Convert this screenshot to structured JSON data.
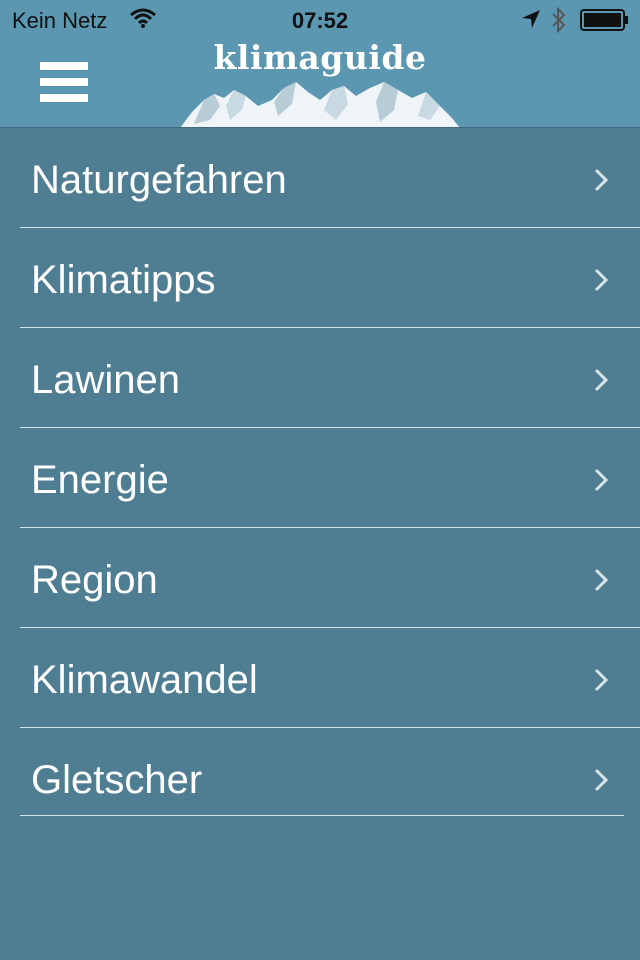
{
  "status_bar": {
    "carrier": "Kein Netz",
    "time": "07:52"
  },
  "header": {
    "logo_text": "klimaguide",
    "menu_icon": "hamburger-menu-icon"
  },
  "menu": {
    "items": [
      {
        "label": "Naturgefahren"
      },
      {
        "label": "Klimatipps"
      },
      {
        "label": "Lawinen"
      },
      {
        "label": "Energie"
      },
      {
        "label": "Region"
      },
      {
        "label": "Klimawandel"
      },
      {
        "label": "Gletscher"
      }
    ],
    "chevron_icon": "chevron-right-icon"
  },
  "colors": {
    "header_bg": "#5b97b1",
    "list_bg": "#4f7e93",
    "separator": "#cfe0e8",
    "text": "#ffffff"
  }
}
